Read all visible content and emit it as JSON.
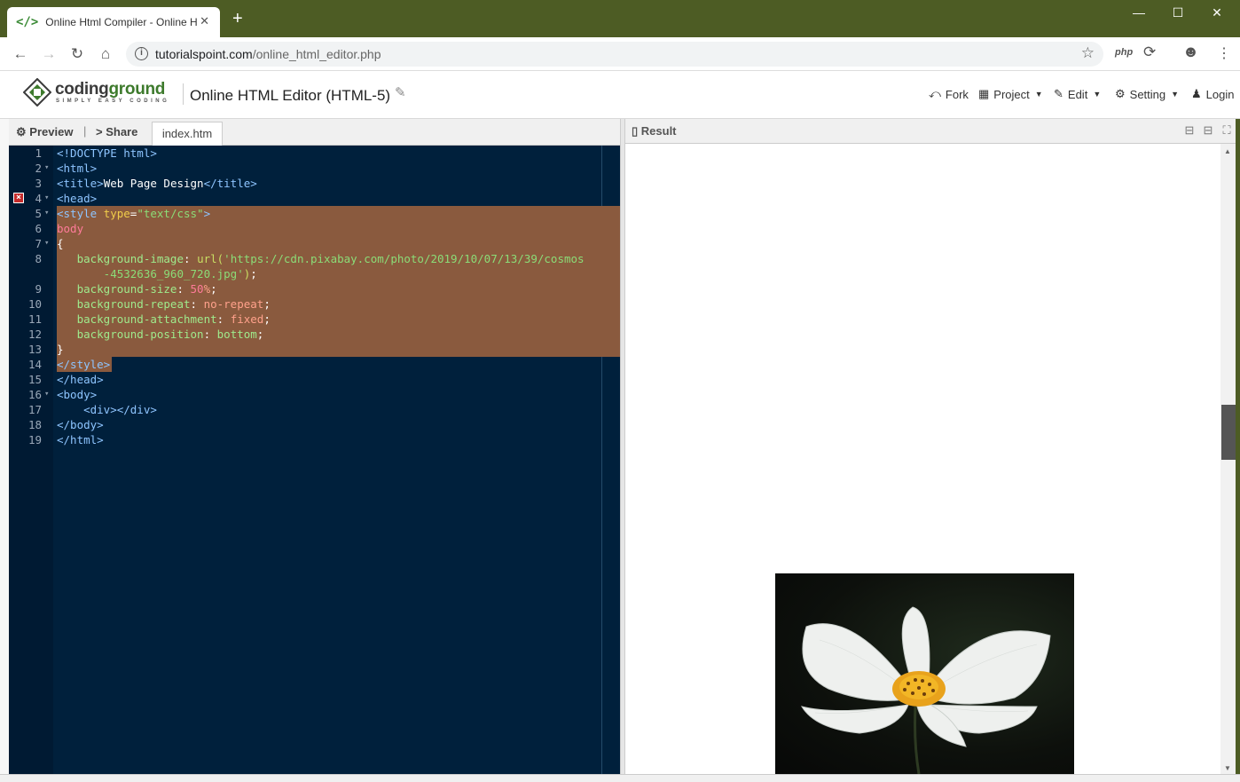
{
  "browser": {
    "tab_title": "Online Html Compiler - Online H",
    "tab_favicon": "</>",
    "tab_close": "✕",
    "new_tab": "+",
    "url_host": "tutorialspoint.com",
    "url_path": "/online_html_editor.php",
    "ext_php": "php"
  },
  "site": {
    "logo_text_1": "coding",
    "logo_text_2": "ground",
    "logo_tagline": "SIMPLY EASY CODING",
    "page_title": "Online HTML Editor (HTML-5)",
    "menu": {
      "fork": "Fork",
      "project": "Project",
      "edit": "Edit",
      "setting": "Setting",
      "login": "Login"
    }
  },
  "editor": {
    "preview_label": "Preview",
    "share_label": "Share",
    "file_tab": "index.htm",
    "line_numbers": [
      "1",
      "2",
      "3",
      "4",
      "5",
      "6",
      "7",
      "8",
      "",
      "9",
      "10",
      "11",
      "12",
      "13",
      "14",
      "15",
      "16",
      "17",
      "18",
      "19"
    ]
  },
  "result": {
    "label": "Result"
  },
  "colors": {
    "titlebar": "#4d5c24",
    "editor_bg": "#00203c",
    "selection": "#8a5a3e"
  }
}
